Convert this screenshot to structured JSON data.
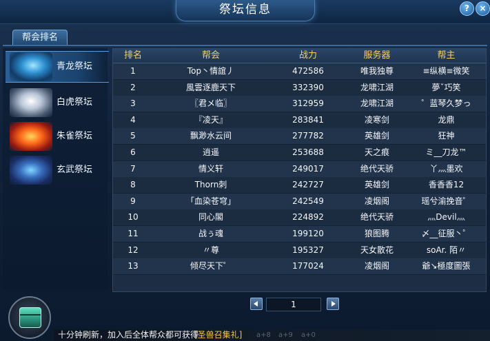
{
  "window": {
    "title": "祭坛信息",
    "help_label": "?",
    "close_label": "×"
  },
  "tab": {
    "label": "帮会排名"
  },
  "altars": [
    {
      "label": "青龙祭坛",
      "icon": "azure-dragon-emblem",
      "active": true
    },
    {
      "label": "白虎祭坛",
      "icon": "white-tiger-emblem",
      "active": false
    },
    {
      "label": "朱雀祭坛",
      "icon": "vermilion-bird-emblem",
      "active": false
    },
    {
      "label": "玄武祭坛",
      "icon": "black-tortoise-emblem",
      "active": false
    }
  ],
  "table": {
    "headers": {
      "rank": "排名",
      "guild": "帮会",
      "power": "战力",
      "server": "服务器",
      "leader": "帮主"
    },
    "rows": [
      {
        "rank": "1",
        "guild": "Top丶情誼丿",
        "power": "472586",
        "server": "唯我独尊",
        "leader": "≡纵横≡微笑"
      },
      {
        "rank": "2",
        "guild": "風雲逐鹿天下",
        "power": "332390",
        "server": "龙啸江湖",
        "leader": "夢ˇ巧笑"
      },
      {
        "rank": "3",
        "guild": "〖君メ临〗",
        "power": "312959",
        "server": "龙啸江湖",
        "leader": "゜蓝琴久梦っ"
      },
      {
        "rank": "4",
        "guild": "『凌天』",
        "power": "283841",
        "server": "凌寒剑",
        "leader": "龙鼎"
      },
      {
        "rank": "5",
        "guild": "飘渺水云间",
        "power": "277782",
        "server": "英雄剑",
        "leader": "狂神"
      },
      {
        "rank": "6",
        "guild": "逍遥",
        "power": "253688",
        "server": "天之痕",
        "leader": "ミ__刀龙™"
      },
      {
        "rank": "7",
        "guild": "情义轩",
        "power": "249017",
        "server": "绝代天骄",
        "leader": "丫灬墨欢"
      },
      {
        "rank": "8",
        "guild": "Thorn刺",
        "power": "242727",
        "server": "英雄剑",
        "leader": "香香香12"
      },
      {
        "rank": "9",
        "guild": "「血染苍穹」",
        "power": "242549",
        "server": "凌烟阁",
        "leader": "瑶兮渝挽音゜"
      },
      {
        "rank": "10",
        "guild": "同心閣",
        "power": "224892",
        "server": "绝代天骄",
        "leader": "灬Devil灬"
      },
      {
        "rank": "11",
        "guild": "战ぅ魂",
        "power": "199120",
        "server": "狼图腾",
        "leader": "〆__征服丶゜"
      },
      {
        "rank": "12",
        "guild": "〃尊",
        "power": "195327",
        "server": "天女散花",
        "leader": "soAr. 陌〃"
      },
      {
        "rank": "13",
        "guild": "倾尽天下゜",
        "power": "177024",
        "server": "凌烟阁",
        "leader": "爺↘極度圖張"
      }
    ]
  },
  "pagination": {
    "current_page": "1"
  },
  "footer": {
    "notice": "十分钟刷新，加入后全体帮众都可获得",
    "reward_link": "[圣兽召集礼]"
  },
  "faded_labels": [
    "a+8",
    "a+9",
    "a+0"
  ],
  "colors": {
    "header_text": "#f2d06a",
    "link": "#f5c542",
    "accent": "#5d9ad6"
  }
}
